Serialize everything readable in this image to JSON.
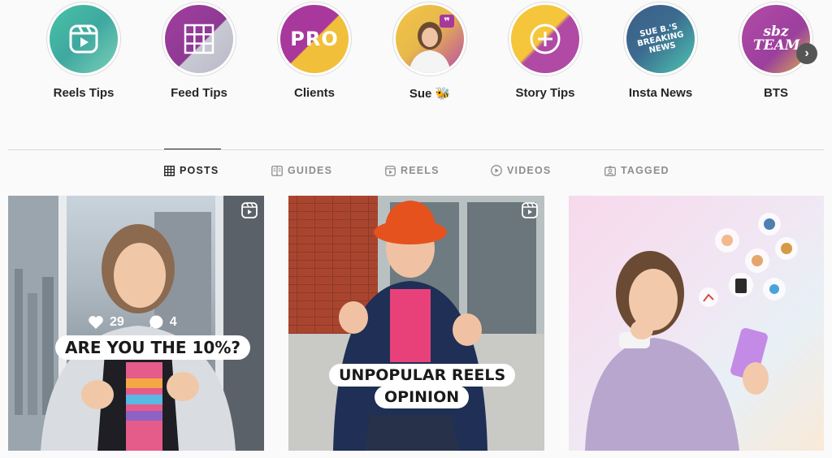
{
  "highlights": [
    {
      "label": "Reels Tips",
      "icon": "reels-icon"
    },
    {
      "label": "Feed Tips",
      "icon": "grid-icon"
    },
    {
      "label": "Clients",
      "icon": "pro-badge",
      "art_text": "PRO"
    },
    {
      "label": "Sue 🐝",
      "icon": "sue-portrait"
    },
    {
      "label": "Story Tips",
      "icon": "plus-icon"
    },
    {
      "label": "Insta News",
      "icon": "news-text",
      "art_text": "SUE B.'S BREAKING NEWS"
    },
    {
      "label": "BTS",
      "icon": "sbz-team-logo",
      "art_text": "sbz TEAM"
    }
  ],
  "highlights_next": "›",
  "tabs": [
    {
      "label": "POSTS",
      "icon": "posts-grid-icon",
      "active": true
    },
    {
      "label": "GUIDES",
      "icon": "guides-icon",
      "active": false
    },
    {
      "label": "REELS",
      "icon": "reels-tab-icon",
      "active": false
    },
    {
      "label": "VIDEOS",
      "icon": "videos-icon",
      "active": false
    },
    {
      "label": "TAGGED",
      "icon": "tagged-icon",
      "active": false
    }
  ],
  "posts": [
    {
      "caption": "ARE YOU THE 10%?",
      "likes": "29",
      "comments": "4",
      "is_reel": true
    },
    {
      "caption_line1": "UNPOPULAR REELS",
      "caption_line2": "OPINION",
      "is_reel": true
    },
    {
      "is_reel": false
    }
  ],
  "colors": {
    "text": "#262626",
    "muted": "#8e8e8e",
    "border": "#dbdbdb",
    "highlight_purple": "#9b3fa3",
    "highlight_green": "#4cc3a3",
    "highlight_yellow": "#f4c23c"
  }
}
